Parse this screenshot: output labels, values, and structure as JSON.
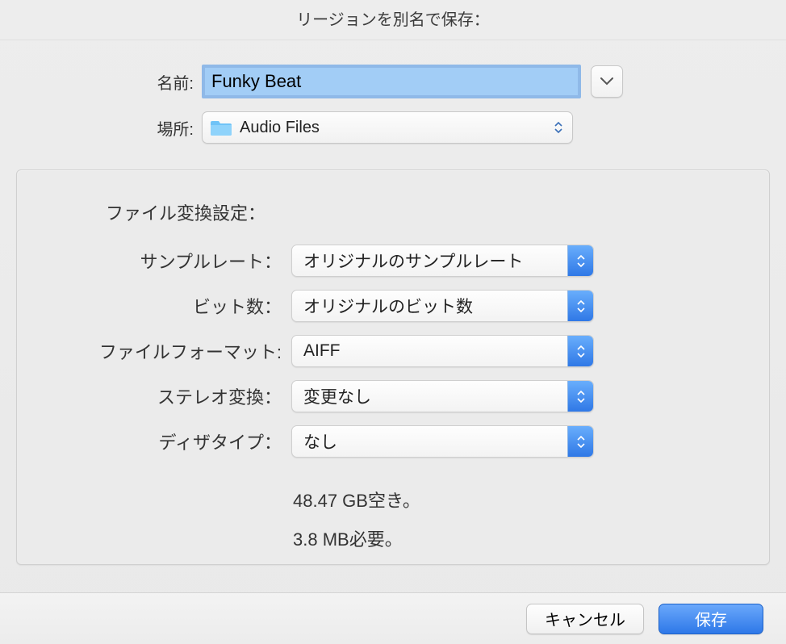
{
  "title": "リージョンを別名で保存：",
  "name_row": {
    "label": "名前:",
    "value": "Funky Beat"
  },
  "location_row": {
    "label": "場所:",
    "folder_name": "Audio Files"
  },
  "settings": {
    "heading": "ファイル変換設定：",
    "sample_rate": {
      "label": "サンプルレート：",
      "value": "オリジナルのサンプルレート"
    },
    "bit_depth": {
      "label": "ビット数：",
      "value": "オリジナルのビット数"
    },
    "file_format": {
      "label": "ファイルフォーマット:",
      "value": "AIFF"
    },
    "stereo": {
      "label": "ステレオ変換：",
      "value": "変更なし"
    },
    "dither": {
      "label": "ディザタイプ：",
      "value": "なし"
    }
  },
  "status": {
    "free": "48.47 GB空き。",
    "needed": "3.8 MB必要。"
  },
  "buttons": {
    "cancel": "キャンセル",
    "save": "保存"
  }
}
